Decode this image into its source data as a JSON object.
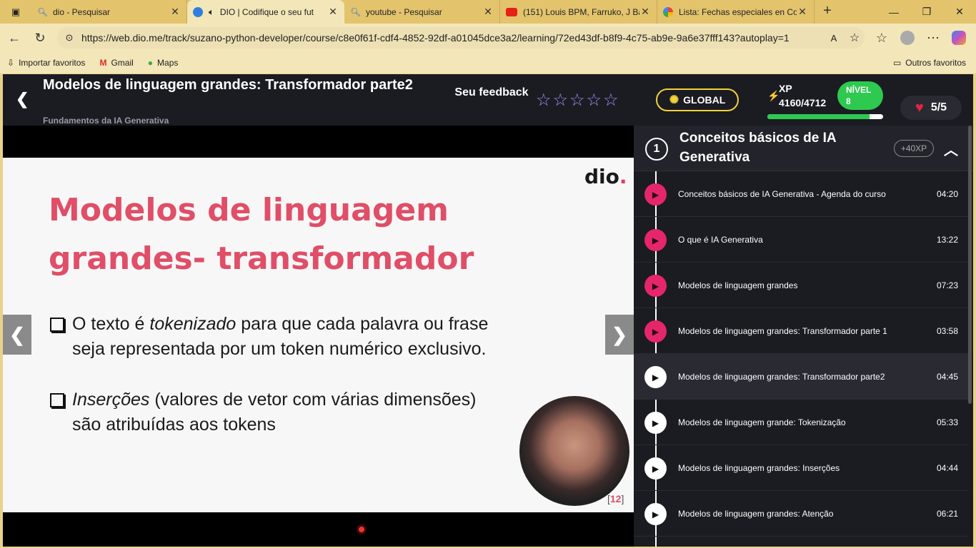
{
  "browser": {
    "tabs": [
      {
        "title": "dio - Pesquisar",
        "favicon": "search-icon",
        "active": false
      },
      {
        "title": "DIO | Codifique o seu fut",
        "favicon": "dio-icon",
        "active": true
      },
      {
        "title": "youtube - Pesquisar",
        "favicon": "search-icon",
        "active": false
      },
      {
        "title": "(151) Louis BPM, Farruko, J Ba",
        "favicon": "youtube-icon",
        "active": false
      },
      {
        "title": "Lista: Fechas especiales en Co",
        "favicon": "google-icon",
        "active": false
      }
    ],
    "url": "https://web.dio.me/track/suzano-python-developer/course/c8e0f61f-cdf4-4852-92df-a01045dce3a2/learning/72ed43df-b8f9-4c75-ab9e-9a6e37fff143?autoplay=1",
    "bookmarks": [
      "Importar favoritos",
      "Gmail",
      "Maps"
    ],
    "other_favorites": "Outros favoritos"
  },
  "header": {
    "title": "Modelos de linguagem grandes: Transformador parte2",
    "subtitle": "Fundamentos da IA Generativa",
    "feedback_label": "Seu feedback",
    "global_label": "GLOBAL",
    "xp_label": "XP",
    "xp_value": "4160/4712",
    "xp_progress": 0.883,
    "level_label": "NÍVEL",
    "level_value": "8",
    "lives": "5/5"
  },
  "slide": {
    "logo": "dio",
    "title": "Modelos de linguagem grandes- transformador",
    "bullet1_a": "O texto é ",
    "bullet1_em": "tokenizado",
    "bullet1_b": " para que cada palavra ou frase seja representada por um token numérico exclusivo.",
    "bullet2_em": "Inserções",
    "bullet2_b": " (valores de vetor com várias dimensões) são atribuídas aos tokens",
    "page_number": "12"
  },
  "panel": {
    "section_number": "1",
    "section_title": "Conceitos básicos de IA Generativa",
    "xp_badge": "+40XP",
    "items": [
      {
        "name": "Conceitos básicos de IA Generativa - Agenda do curso",
        "time": "04:20",
        "done": true
      },
      {
        "name": "O que é IA Generativa",
        "time": "13:22",
        "done": true
      },
      {
        "name": "Modelos de linguagem grandes",
        "time": "07:23",
        "done": true
      },
      {
        "name": "Modelos de linguagem grandes: Transformador parte 1",
        "time": "03:58",
        "done": true
      },
      {
        "name": "Modelos de linguagem grandes: Transformador parte2",
        "time": "04:45",
        "done": false
      },
      {
        "name": "Modelos de linguagem grande: Tokenização",
        "time": "05:33",
        "done": false
      },
      {
        "name": "Modelos de linguagem grandes: Inserções",
        "time": "04:44",
        "done": false
      },
      {
        "name": "Modelos de linguagem grandes: Atenção",
        "time": "06:21",
        "done": false
      }
    ]
  }
}
